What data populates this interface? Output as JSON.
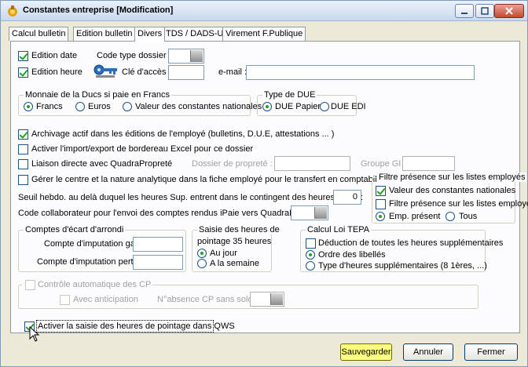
{
  "window": {
    "title": "Constantes entreprise  [Modification]",
    "accent": "#0054e3"
  },
  "tabs": [
    {
      "label": "Calcul bulletin"
    },
    {
      "label": "Edition bulletin"
    },
    {
      "label": "Divers"
    },
    {
      "label": "TDS / DADS-U"
    },
    {
      "label": "Virement F.Publique"
    }
  ],
  "edition": {
    "date_label": "Edition date",
    "date_checked": true,
    "heure_label": "Edition heure",
    "heure_checked": true,
    "code_type_dossier_label": "Code type dossier :",
    "cle_acces_label": "Clé d'accès :",
    "email_label": "e-mail :"
  },
  "monnaie": {
    "title": "Monnaie de la Ducs si paie en Francs",
    "options": [
      "Francs",
      "Euros",
      "Valeur des constantes nationales"
    ],
    "selected": "Francs"
  },
  "type_due": {
    "title": "Type de DUE",
    "options": [
      "DUE Papier",
      "DUE EDI"
    ],
    "selected": "DUE Papier"
  },
  "options": {
    "archivage": "Archivage actif dans les éditions de l'employé (bulletins, D.U.E, attestations ... )",
    "import_export": "Activer l'import/export de bordereau Excel pour ce dossier",
    "liaison": "Liaison directe avec QuadraPropreté",
    "dossier_proprete": "Dossier de propreté :",
    "groupe_gi": "Groupe GI :",
    "gerer_centre": "Gérer le centre et la nature analytique dans la fiche employé pour le transfert en comptabilité"
  },
  "filtre": {
    "title": "Filtre présence sur les listes employés",
    "valeur_constantes": "Valeur des constantes nationales",
    "filtre_presence": "Filtre présence sur les listes employés",
    "emp_present": "Emp. présent",
    "tous": "Tous"
  },
  "seuil": {
    "label": "Seuil hebdo. au delà duquel les heures Sup. entrent dans le contingent des heures supp. :",
    "value": "0"
  },
  "code_collab": {
    "label": "Code collaborateur pour l'envoi des comptes rendus iPaie vers QuadraBureau :"
  },
  "ecart": {
    "title": "Comptes d'écart d'arrondi",
    "gain_label": "Compte d'imputation gain :",
    "pertes_label": "Compte d'imputation pertes :"
  },
  "pointage": {
    "title": "Saisie des heures de",
    "title2": "pointage 35 heures",
    "au_jour": "Au jour",
    "semaine": "A la semaine"
  },
  "tepa": {
    "title": "Calcul Loi TEPA",
    "deduction": "Déduction de toutes les heures supplémentaires",
    "ordre": "Ordre des libellés",
    "type": "Type d'heures supplémentaires (8 1ères, ...)"
  },
  "cp": {
    "title": "Contrôle automatique des CP",
    "anticipation": "Avec anticipation",
    "absence": "N°absence CP sans solde :"
  },
  "qws": {
    "label": "Activer la saisie des heures de pointage dans QWS"
  },
  "buttons": {
    "save": "Sauvegarder",
    "cancel": "Annuler",
    "close": "Fermer"
  }
}
